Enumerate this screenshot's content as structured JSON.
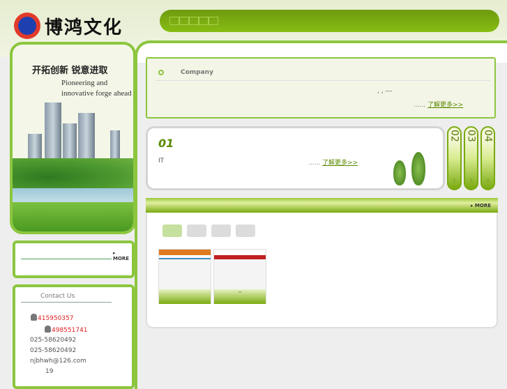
{
  "header": {
    "logo_text": "博鸿文化",
    "nav_items": [
      "",
      "",
      "",
      "",
      ""
    ]
  },
  "banner": {
    "slogan_cn": "开拓创新 锐意进取",
    "slogan_en_1": "Pioneering and",
    "slogan_en_2": "innovative forge ahead"
  },
  "company": {
    "title": "Company",
    "text": ",       ,           ---",
    "more_prefix": "......",
    "more_link": "了解更多>>"
  },
  "tabs": {
    "active_num": "01",
    "active_text": "IT",
    "more_prefix": "......",
    "more_link": "了解更多>>",
    "others": [
      {
        "label": "02",
        "num": "2"
      },
      {
        "label": "03",
        "num": "3"
      },
      {
        "label": "04",
        "num": "4"
      }
    ]
  },
  "products": {
    "more": "MORE",
    "thumbs": [
      {
        "caption": ""
      },
      {
        "caption": "--"
      }
    ]
  },
  "left_box": {
    "more": "MORE"
  },
  "contact": {
    "title": "Contact Us",
    "qq1": "415950357",
    "qq2": "498551741",
    "phone1": "025-58620492",
    "phone2": "025-58620492",
    "email": "njbhwh@126.com",
    "extra": "19"
  }
}
